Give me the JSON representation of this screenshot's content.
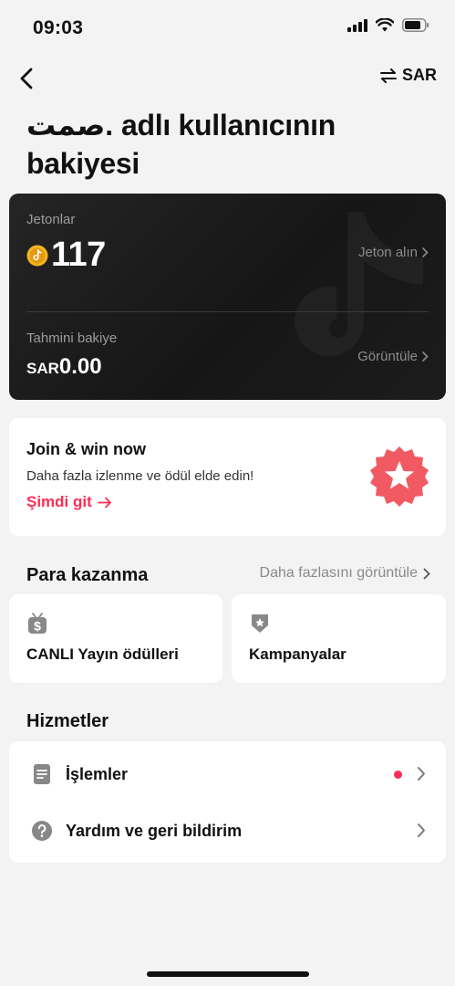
{
  "status_bar": {
    "time": "09:03"
  },
  "nav": {
    "currency_label": "SAR",
    "back_icon": "chevron-left-icon",
    "swap_icon": "swap-arrows-icon"
  },
  "page": {
    "title": "صمت. adlı kullanıcının bakiyesi"
  },
  "balance_card": {
    "coins_label": "Jetonlar",
    "coins_value": "117",
    "get_coins_link": "Jeton alın",
    "estimated_label": "Tahmini bakiye",
    "currency_prefix": "SAR",
    "estimated_value": "0.00",
    "view_link": "Görüntüle"
  },
  "promo": {
    "title": "Join & win now",
    "subtitle": "Daha fazla izlenme ve ödül elde edin!",
    "cta": "Şimdi git"
  },
  "monetization": {
    "heading": "Para kazanma",
    "more_link": "Daha fazlasını görüntüle",
    "tiles": [
      {
        "label": "CANLI Yayın ödülleri",
        "icon": "live-gift-dollar-icon"
      },
      {
        "label": "Kampanyalar",
        "icon": "campaign-badge-icon"
      }
    ]
  },
  "services": {
    "heading": "Hizmetler",
    "items": [
      {
        "label": "İşlemler",
        "icon": "document-icon",
        "has_notification": true
      },
      {
        "label": "Yardım ve geri bildirim",
        "icon": "help-circle-icon",
        "has_notification": false
      }
    ]
  },
  "colors": {
    "accent": "#fe2c55",
    "card_bg": "#1a1a1a",
    "page_bg": "#f3f3f3"
  }
}
